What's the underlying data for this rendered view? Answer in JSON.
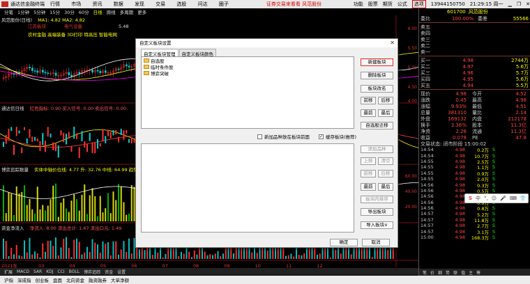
{
  "topbar": {
    "app_title": "通达信金融终端",
    "menu": [
      "行情",
      "市场",
      "资讯",
      "数据",
      "发现",
      "交易",
      "选股",
      "问达",
      "圈子"
    ],
    "promo": "证券交易来看看 风范股份",
    "right_items": [
      "功能",
      "股票",
      "期货",
      "公式",
      "选项"
    ],
    "phone": "13944150750",
    "time": "21:29:15 周一"
  },
  "toolbar": {
    "items": [
      "分笔",
      "1分钟",
      "5分钟",
      "15分",
      "30分",
      "60分",
      "日线",
      "周线",
      "多周期",
      "更多"
    ],
    "active": "日线"
  },
  "chart": {
    "main_title": "风范股份(日线)",
    "ma_text": "MA1: 4.82  MA2: 4.82",
    "tags": [
      "江苏板块",
      "电气设备",
      "农村金融 高端装备 3D打印 特高压 智能电网"
    ],
    "high_label": "5.48",
    "panel2_title": "通达信日线",
    "panel2_vals": "红色指标: 0.90  买入信号: 0.00  卖出信号: 0.00",
    "panel3_title": "博弈追踪数量",
    "panel3_vals": "实体中轴价位线: 4.77  升: 32.76  中线: 64.99  趋势: 27.42",
    "panel4_title": "资金净流入",
    "panel4_vals": "净流入: 8.00  流出总计: 1.67  流出口元: 1.49",
    "right_axis": [
      "6.00",
      "5.50",
      "5.00",
      "4.50",
      "4.00",
      "60.00",
      "40.00",
      "20.00"
    ],
    "dates": [
      "2021年",
      "03",
      "04",
      "05",
      "06",
      "07",
      "08",
      "09",
      "10",
      "11",
      "12"
    ],
    "bottom_tabs": [
      "扩展",
      "MACD",
      "SAR",
      "KDJ",
      "CCI",
      "BOLL",
      "博弈追踪",
      "资金",
      "设置"
    ]
  },
  "quote": {
    "code": "601700",
    "name": "风范股份",
    "webi_label": "委比",
    "webi_value": "100.00%",
    "wecha_label": "委差",
    "wecha_value": "55566",
    "sell": [
      {
        "label": "卖五",
        "price": "",
        "vol": ""
      },
      {
        "label": "卖四",
        "price": "",
        "vol": ""
      },
      {
        "label": "卖三",
        "price": "",
        "vol": ""
      },
      {
        "label": "卖二",
        "price": "",
        "vol": ""
      },
      {
        "label": "卖一",
        "price": "",
        "vol": ""
      }
    ],
    "buy": [
      {
        "label": "买一",
        "price": "4.98",
        "vol": "2744万"
      },
      {
        "label": "买二",
        "price": "4.97",
        "vol": "5.6万"
      },
      {
        "label": "买三",
        "price": "4.96",
        "vol": "5.7万"
      },
      {
        "label": "买四",
        "price": "4.95",
        "vol": "5.6万"
      },
      {
        "label": "买五",
        "price": "4.94",
        "vol": "5.5万"
      }
    ],
    "stats": [
      {
        "k1": "现价",
        "v1": "4.98",
        "k2": "今开",
        "v2": "4.52"
      },
      {
        "k1": "涨跌",
        "v1": "0.45",
        "k2": "最高",
        "v2": "4.98"
      },
      {
        "k1": "涨幅",
        "v1": "9.93%",
        "k2": "最低",
        "v2": "4.51"
      },
      {
        "k1": "总量",
        "v1": "381310",
        "k2": "量比",
        "v2": "2.14"
      },
      {
        "k1": "外盘",
        "v1": "169132",
        "k2": "内盘",
        "v2": "212178"
      },
      {
        "k1": "换手",
        "v1": "3.36%",
        "k2": "股本",
        "v2": "11.3亿"
      },
      {
        "k1": "净资",
        "v1": "2.26",
        "k2": "流通",
        "v2": "11.3亿"
      },
      {
        "k1": "收益",
        "v1": "0.078",
        "k2": "PE",
        "v2": "47.8"
      }
    ],
    "trade_status": "交易状态: 闭市阶段 15:00:02",
    "ticks": [
      {
        "t": "14:54",
        "p": "4.98",
        "v": "0.2万",
        "s": "S"
      },
      {
        "t": "14:54",
        "p": "4.98",
        "v": "10.7万",
        "s": "S"
      },
      {
        "t": "14:55",
        "p": "4.98",
        "v": "2.5万",
        "s": "S"
      },
      {
        "t": "14:55",
        "p": "4.98",
        "v": "1.1万",
        "s": "S"
      },
      {
        "t": "14:55",
        "p": "4.98",
        "v": "0.9万",
        "s": "S"
      },
      {
        "t": "14:55",
        "p": "4.98",
        "v": "2.0万",
        "s": "S"
      },
      {
        "t": "14:56",
        "p": "4.98",
        "v": "0.3万",
        "s": "S"
      },
      {
        "t": "14:56",
        "p": "4.98",
        "v": "0.5万",
        "s": "S"
      },
      {
        "t": "14:56",
        "p": "4.98",
        "v": "1.4万",
        "s": "S"
      },
      {
        "t": "14:56",
        "p": "4.98",
        "v": "0.9万",
        "s": "S"
      },
      {
        "t": "14:56",
        "p": "4.98",
        "v": "0.8万",
        "s": "S"
      },
      {
        "t": "14:57",
        "p": "4.98",
        "v": "5.2万",
        "s": "S"
      },
      {
        "t": "14:57",
        "p": "4.98",
        "v": "11.8万",
        "s": "S"
      },
      {
        "t": "14:57",
        "p": "4.98",
        "v": "2.7万",
        "s": "S"
      },
      {
        "t": "14:57",
        "p": "4.98",
        "v": "3.1万",
        "s": "S"
      },
      {
        "t": "15:00",
        "p": "4.98",
        "v": "168.3万",
        "s": "S"
      }
    ],
    "tabs": [
      "笔",
      "价",
      "细",
      "势",
      "联",
      "值",
      "主",
      "筹"
    ]
  },
  "ime": {
    "items": [
      "中",
      "°,",
      "☺",
      "🎤",
      "⌨",
      "👕",
      "⋯"
    ]
  },
  "dialog": {
    "title": "自定义板块设置",
    "tabs": [
      "自定义板块管理",
      "自定义板块颜色"
    ],
    "active_tab": "自定义板块管理",
    "boards": [
      "自选股",
      "临时条件股",
      "博弈突破"
    ],
    "checkbox1": "新加品种放在板块前面",
    "checkbox2": "缓存板块(推荐)",
    "checkbox2_checked": true,
    "buttons_top": [
      "新建板块",
      "删除板块",
      "板块改名"
    ],
    "buttons_move": [
      "前移",
      "后移",
      "最前",
      "最后"
    ],
    "button_save": "自选股迁移",
    "buttons_bottom": [
      "添加品种",
      "上移",
      "清空",
      "前移",
      "后移",
      "最前",
      "最后",
      "板块内排序",
      "导出板块",
      "导入板块∨"
    ],
    "ok": "确定",
    "cancel": "取消"
  },
  "statusbar": {
    "items": [
      "沪指",
      "深成指",
      "创业板",
      "盘面",
      "北向资金",
      "融资融券",
      "大单净额"
    ]
  }
}
